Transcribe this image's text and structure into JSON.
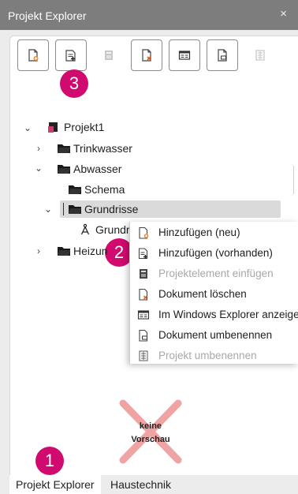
{
  "window": {
    "title": "Projekt Explorer",
    "close_glyph": "×"
  },
  "toolbar": {
    "buttons": [
      {
        "name": "new-document-button",
        "icon": "doc-plus-icon",
        "enabled": true
      },
      {
        "name": "add-existing-button",
        "icon": "doc-stack-plus-icon",
        "enabled": true
      },
      {
        "name": "insert-element-button",
        "icon": "element-insert-icon",
        "enabled": false
      },
      {
        "name": "delete-document-button",
        "icon": "doc-x-icon",
        "enabled": true
      },
      {
        "name": "open-explorer-button",
        "icon": "explorer-window-icon",
        "enabled": true
      },
      {
        "name": "rename-document-button",
        "icon": "doc-rename-icon",
        "enabled": true
      },
      {
        "name": "rename-project-button",
        "icon": "project-rename-icon",
        "enabled": false
      }
    ]
  },
  "badges": {
    "b1": "1",
    "b2": "2",
    "b3": "3"
  },
  "tree": {
    "project": "Projekt1",
    "trinkwasser": "Trinkwasser",
    "abwasser": "Abwasser",
    "schema": "Schema",
    "grundrisse": "Grundrisse",
    "grundriss_child": "Grundri",
    "heizung": "Heizun"
  },
  "context_menu": {
    "items": [
      {
        "label": "Hinzufügen (neu)",
        "enabled": true
      },
      {
        "label": "Hinzufügen (vorhanden)",
        "enabled": true
      },
      {
        "label": "Projektelement einfügen",
        "enabled": false
      },
      {
        "label": "Dokument löschen",
        "enabled": true
      },
      {
        "label": "Im Windows Explorer anzeigen",
        "enabled": true
      },
      {
        "label": "Dokument umbenennen",
        "enabled": true
      },
      {
        "label": "Projekt umbenennen",
        "enabled": false
      }
    ]
  },
  "preview": {
    "line1": "keine",
    "line2": "Vorschau"
  },
  "tabs": {
    "t1": "Projekt Explorer",
    "t2": "Haustechnik",
    "active": "Projekt Explorer"
  },
  "colors": {
    "badge": "#d10a6f",
    "preview_x": "#f0a3a3",
    "titlebar": "#7d7d7d"
  }
}
